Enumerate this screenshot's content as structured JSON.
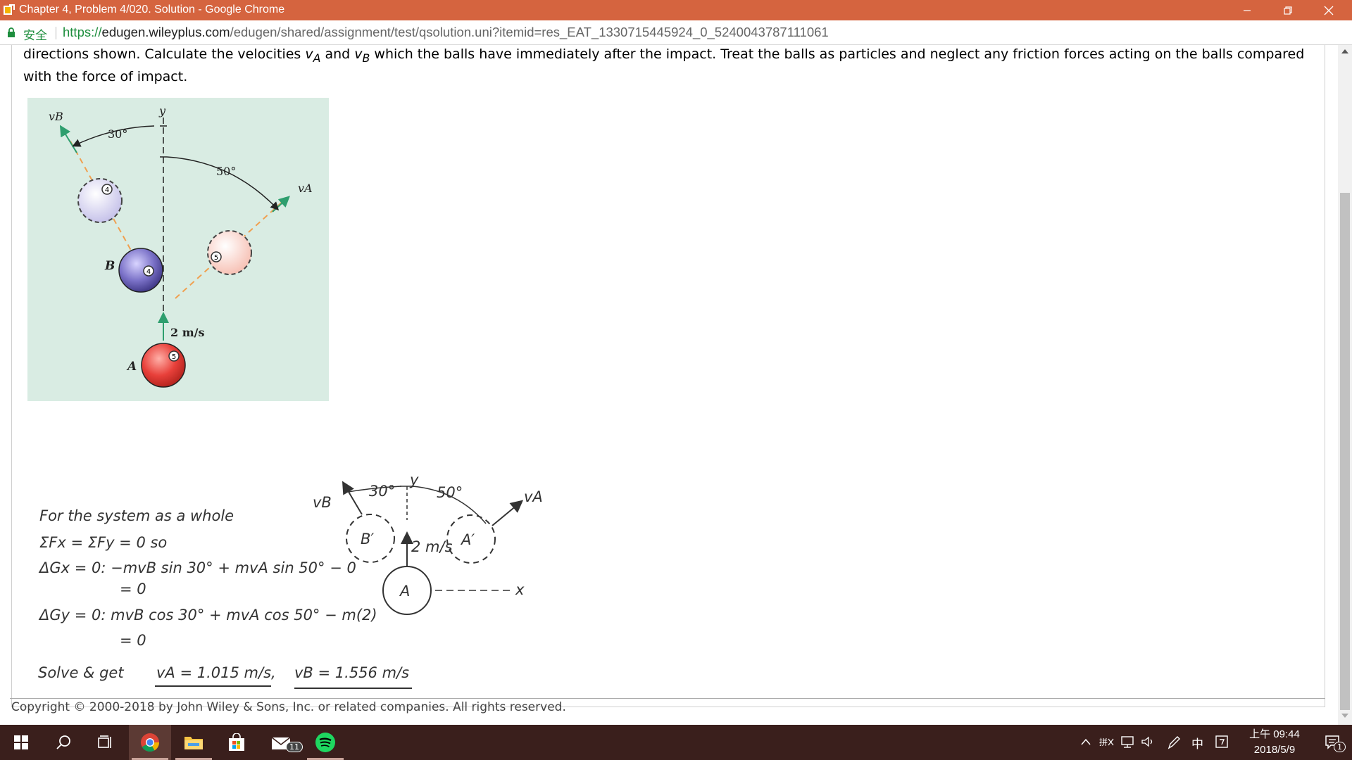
{
  "window": {
    "title": "Chapter 4, Problem 4/020. Solution - Google Chrome"
  },
  "address_bar": {
    "secure_label": "安全",
    "url_protocol": "https://",
    "url_host": "edugen.wileyplus.com",
    "url_path": "/edugen/shared/assignment/test/qsolution.uni?itemid=res_EAT_1330715445924_0_5240043787111061"
  },
  "problem": {
    "text_1": "directions shown. Calculate the velocities ",
    "va": "v",
    "va_sub": "A",
    "text_2": " and ",
    "vb": "v",
    "vb_sub": "B",
    "text_3": " which the balls have immediately after the impact. Treat the balls as particles and neglect any friction forces acting on the balls compared with the force of impact."
  },
  "figure": {
    "vb_label": "vB",
    "y_label": "y",
    "angle_30": "30°",
    "angle_50": "50°",
    "va_label": "vA",
    "ball_b_label": "B",
    "ball_a_label": "A",
    "speed_label": "2 m/s",
    "ball_b_number": "4",
    "ball_a_number": "5",
    "ball_b_final_number": "4",
    "ball_a_final_number": "5"
  },
  "solution": {
    "line1": "For the system as a whole",
    "line2": "ΣFx = ΣFy = 0 so",
    "line3": "ΔGx = 0: −mvB sin 30° + mvA sin 50° − 0",
    "line4": "= 0",
    "line5": "ΔGy = 0: mvB cos 30° + mvA cos 50° − m(2)",
    "line6": "= 0",
    "line7_prefix": "Solve & get",
    "answer_va": "vA = 1.015 m/s,",
    "answer_vb": "vB = 1.556 m/s",
    "sketch": {
      "vb": "vB",
      "va": "vA",
      "angle_30": "30°",
      "angle_50": "50°",
      "y": "y",
      "x": "x",
      "b_prime": "B′",
      "a_prime": "A′",
      "a": "A",
      "speed": "2 m/s"
    }
  },
  "footer": {
    "copyright": "Copyright © 2000-2018 by John Wiley & Sons, Inc. or related companies. All rights reserved."
  },
  "taskbar": {
    "mail_badge": "11",
    "ime_label": "中",
    "clock_time": "上午 09:44",
    "clock_date": "2018/5/9",
    "notification_badge": "1"
  },
  "colors": {
    "titlebar": "#d5643f",
    "taskbar": "#3a1f1c",
    "figure_bg": "#d9ece3",
    "ball_a": "#e8403a",
    "ball_b": "#7b72c8",
    "vector_green": "#2e9e6e",
    "trajectory_orange": "#f0a050"
  }
}
